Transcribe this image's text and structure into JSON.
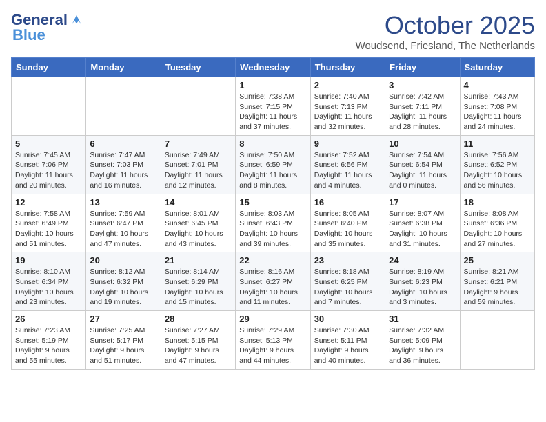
{
  "logo": {
    "general": "General",
    "blue": "Blue"
  },
  "header": {
    "month": "October 2025",
    "location": "Woudsend, Friesland, The Netherlands"
  },
  "days_of_week": [
    "Sunday",
    "Monday",
    "Tuesday",
    "Wednesday",
    "Thursday",
    "Friday",
    "Saturday"
  ],
  "weeks": [
    [
      {
        "day": "",
        "info": ""
      },
      {
        "day": "",
        "info": ""
      },
      {
        "day": "",
        "info": ""
      },
      {
        "day": "1",
        "info": "Sunrise: 7:38 AM\nSunset: 7:15 PM\nDaylight: 11 hours and 37 minutes."
      },
      {
        "day": "2",
        "info": "Sunrise: 7:40 AM\nSunset: 7:13 PM\nDaylight: 11 hours and 32 minutes."
      },
      {
        "day": "3",
        "info": "Sunrise: 7:42 AM\nSunset: 7:11 PM\nDaylight: 11 hours and 28 minutes."
      },
      {
        "day": "4",
        "info": "Sunrise: 7:43 AM\nSunset: 7:08 PM\nDaylight: 11 hours and 24 minutes."
      }
    ],
    [
      {
        "day": "5",
        "info": "Sunrise: 7:45 AM\nSunset: 7:06 PM\nDaylight: 11 hours and 20 minutes."
      },
      {
        "day": "6",
        "info": "Sunrise: 7:47 AM\nSunset: 7:03 PM\nDaylight: 11 hours and 16 minutes."
      },
      {
        "day": "7",
        "info": "Sunrise: 7:49 AM\nSunset: 7:01 PM\nDaylight: 11 hours and 12 minutes."
      },
      {
        "day": "8",
        "info": "Sunrise: 7:50 AM\nSunset: 6:59 PM\nDaylight: 11 hours and 8 minutes."
      },
      {
        "day": "9",
        "info": "Sunrise: 7:52 AM\nSunset: 6:56 PM\nDaylight: 11 hours and 4 minutes."
      },
      {
        "day": "10",
        "info": "Sunrise: 7:54 AM\nSunset: 6:54 PM\nDaylight: 11 hours and 0 minutes."
      },
      {
        "day": "11",
        "info": "Sunrise: 7:56 AM\nSunset: 6:52 PM\nDaylight: 10 hours and 56 minutes."
      }
    ],
    [
      {
        "day": "12",
        "info": "Sunrise: 7:58 AM\nSunset: 6:49 PM\nDaylight: 10 hours and 51 minutes."
      },
      {
        "day": "13",
        "info": "Sunrise: 7:59 AM\nSunset: 6:47 PM\nDaylight: 10 hours and 47 minutes."
      },
      {
        "day": "14",
        "info": "Sunrise: 8:01 AM\nSunset: 6:45 PM\nDaylight: 10 hours and 43 minutes."
      },
      {
        "day": "15",
        "info": "Sunrise: 8:03 AM\nSunset: 6:43 PM\nDaylight: 10 hours and 39 minutes."
      },
      {
        "day": "16",
        "info": "Sunrise: 8:05 AM\nSunset: 6:40 PM\nDaylight: 10 hours and 35 minutes."
      },
      {
        "day": "17",
        "info": "Sunrise: 8:07 AM\nSunset: 6:38 PM\nDaylight: 10 hours and 31 minutes."
      },
      {
        "day": "18",
        "info": "Sunrise: 8:08 AM\nSunset: 6:36 PM\nDaylight: 10 hours and 27 minutes."
      }
    ],
    [
      {
        "day": "19",
        "info": "Sunrise: 8:10 AM\nSunset: 6:34 PM\nDaylight: 10 hours and 23 minutes."
      },
      {
        "day": "20",
        "info": "Sunrise: 8:12 AM\nSunset: 6:32 PM\nDaylight: 10 hours and 19 minutes."
      },
      {
        "day": "21",
        "info": "Sunrise: 8:14 AM\nSunset: 6:29 PM\nDaylight: 10 hours and 15 minutes."
      },
      {
        "day": "22",
        "info": "Sunrise: 8:16 AM\nSunset: 6:27 PM\nDaylight: 10 hours and 11 minutes."
      },
      {
        "day": "23",
        "info": "Sunrise: 8:18 AM\nSunset: 6:25 PM\nDaylight: 10 hours and 7 minutes."
      },
      {
        "day": "24",
        "info": "Sunrise: 8:19 AM\nSunset: 6:23 PM\nDaylight: 10 hours and 3 minutes."
      },
      {
        "day": "25",
        "info": "Sunrise: 8:21 AM\nSunset: 6:21 PM\nDaylight: 9 hours and 59 minutes."
      }
    ],
    [
      {
        "day": "26",
        "info": "Sunrise: 7:23 AM\nSunset: 5:19 PM\nDaylight: 9 hours and 55 minutes."
      },
      {
        "day": "27",
        "info": "Sunrise: 7:25 AM\nSunset: 5:17 PM\nDaylight: 9 hours and 51 minutes."
      },
      {
        "day": "28",
        "info": "Sunrise: 7:27 AM\nSunset: 5:15 PM\nDaylight: 9 hours and 47 minutes."
      },
      {
        "day": "29",
        "info": "Sunrise: 7:29 AM\nSunset: 5:13 PM\nDaylight: 9 hours and 44 minutes."
      },
      {
        "day": "30",
        "info": "Sunrise: 7:30 AM\nSunset: 5:11 PM\nDaylight: 9 hours and 40 minutes."
      },
      {
        "day": "31",
        "info": "Sunrise: 7:32 AM\nSunset: 5:09 PM\nDaylight: 9 hours and 36 minutes."
      },
      {
        "day": "",
        "info": ""
      }
    ]
  ]
}
